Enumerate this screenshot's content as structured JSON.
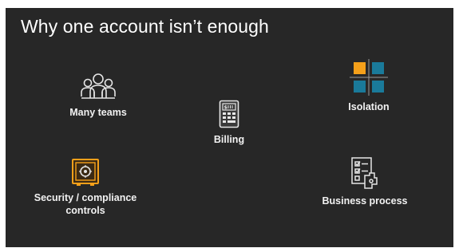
{
  "slide": {
    "title": "Why one account isn’t enough",
    "background_color": "#272727"
  },
  "items": {
    "many_teams": {
      "label": "Many teams",
      "icon": "people-group-icon"
    },
    "billing": {
      "label": "Billing",
      "icon": "bill-icon"
    },
    "isolation": {
      "label": "Isolation",
      "icon": "isolated-grid-icon"
    },
    "security": {
      "label": "Security / compliance\ncontrols",
      "icon": "vault-icon"
    },
    "business_process": {
      "label": "Business process",
      "icon": "process-checklist-icon"
    }
  },
  "colors": {
    "accent_orange": "#f5a01a",
    "accent_teal": "#1a7a9a",
    "icon_stroke": "#e6e6e6"
  }
}
